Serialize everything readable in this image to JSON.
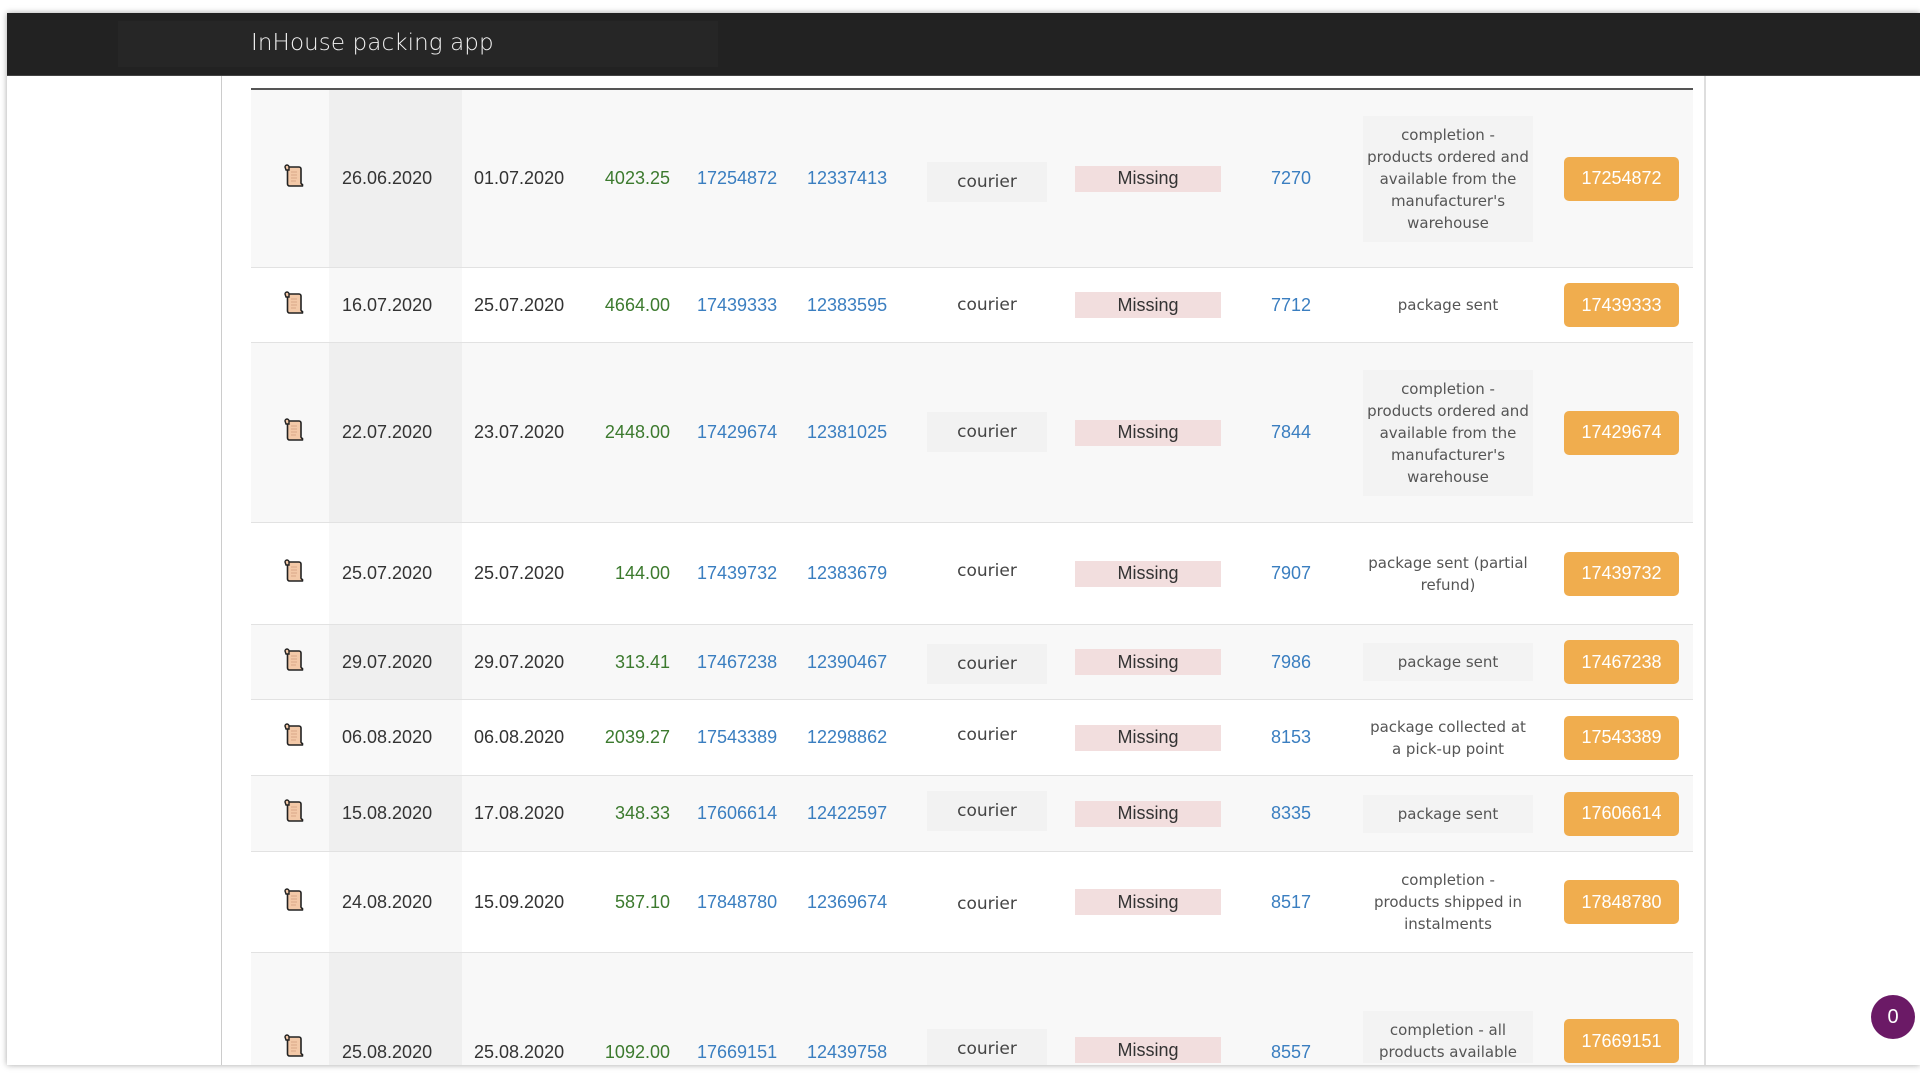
{
  "app": {
    "title": "InHouse packing app"
  },
  "chat": {
    "count": "0"
  },
  "colors": {
    "amount": "#3c7a2e",
    "link": "#3a7ec0",
    "missing_bg": "#f2dede",
    "button": "#f0ad4e",
    "header": "#222222",
    "chat_badge": "#6b1a66"
  },
  "rows": [
    {
      "icon": "scroll-icon",
      "created": "26.06.2020",
      "updated": "01.07.2020",
      "amount": "4023.25",
      "order_id": "17254872",
      "ref_id": "12337413",
      "carrier": "courier",
      "tracking": "Missing",
      "number": "7270",
      "status": "completion - products ordered and available from the manufacturer's warehouse",
      "button": "17254872"
    },
    {
      "icon": "scroll-icon",
      "created": "16.07.2020",
      "updated": "25.07.2020",
      "amount": "4664.00",
      "order_id": "17439333",
      "ref_id": "12383595",
      "carrier": "courier",
      "tracking": "Missing",
      "number": "7712",
      "status": "package sent",
      "button": "17439333"
    },
    {
      "icon": "scroll-icon",
      "created": "22.07.2020",
      "updated": "23.07.2020",
      "amount": "2448.00",
      "order_id": "17429674",
      "ref_id": "12381025",
      "carrier": "courier",
      "tracking": "Missing",
      "number": "7844",
      "status": "completion - products ordered and available from the manufacturer's warehouse",
      "button": "17429674"
    },
    {
      "icon": "scroll-icon",
      "created": "25.07.2020",
      "updated": "25.07.2020",
      "amount": "144.00",
      "order_id": "17439732",
      "ref_id": "12383679",
      "carrier": "courier",
      "tracking": "Missing",
      "number": "7907",
      "status": "package sent (partial refund)",
      "button": "17439732"
    },
    {
      "icon": "scroll-icon",
      "created": "29.07.2020",
      "updated": "29.07.2020",
      "amount": "313.41",
      "order_id": "17467238",
      "ref_id": "12390467",
      "carrier": "courier",
      "tracking": "Missing",
      "number": "7986",
      "status": "package sent",
      "button": "17467238"
    },
    {
      "icon": "scroll-icon",
      "created": "06.08.2020",
      "updated": "06.08.2020",
      "amount": "2039.27",
      "order_id": "17543389",
      "ref_id": "12298862",
      "carrier": "courier",
      "tracking": "Missing",
      "number": "8153",
      "status": "package collected at a pick-up point",
      "button": "17543389"
    },
    {
      "icon": "scroll-icon",
      "created": "15.08.2020",
      "updated": "17.08.2020",
      "amount": "348.33",
      "order_id": "17606614",
      "ref_id": "12422597",
      "carrier": "courier",
      "tracking": "Missing",
      "number": "8335",
      "status": "package sent",
      "button": "17606614"
    },
    {
      "icon": "scroll-icon",
      "created": "24.08.2020",
      "updated": "15.09.2020",
      "amount": "587.10",
      "order_id": "17848780",
      "ref_id": "12369674",
      "carrier": "courier",
      "tracking": "Missing",
      "number": "8517",
      "status": "completion - products shipped in instalments",
      "button": "17848780"
    },
    {
      "icon": "scroll-icon",
      "created": "25.08.2020",
      "updated": "25.08.2020",
      "amount": "1092.00",
      "order_id": "17669151",
      "ref_id": "12439758",
      "carrier": "courier",
      "tracking": "Missing",
      "number": "8557",
      "status": "completion - all products available",
      "button": "17669151"
    }
  ]
}
